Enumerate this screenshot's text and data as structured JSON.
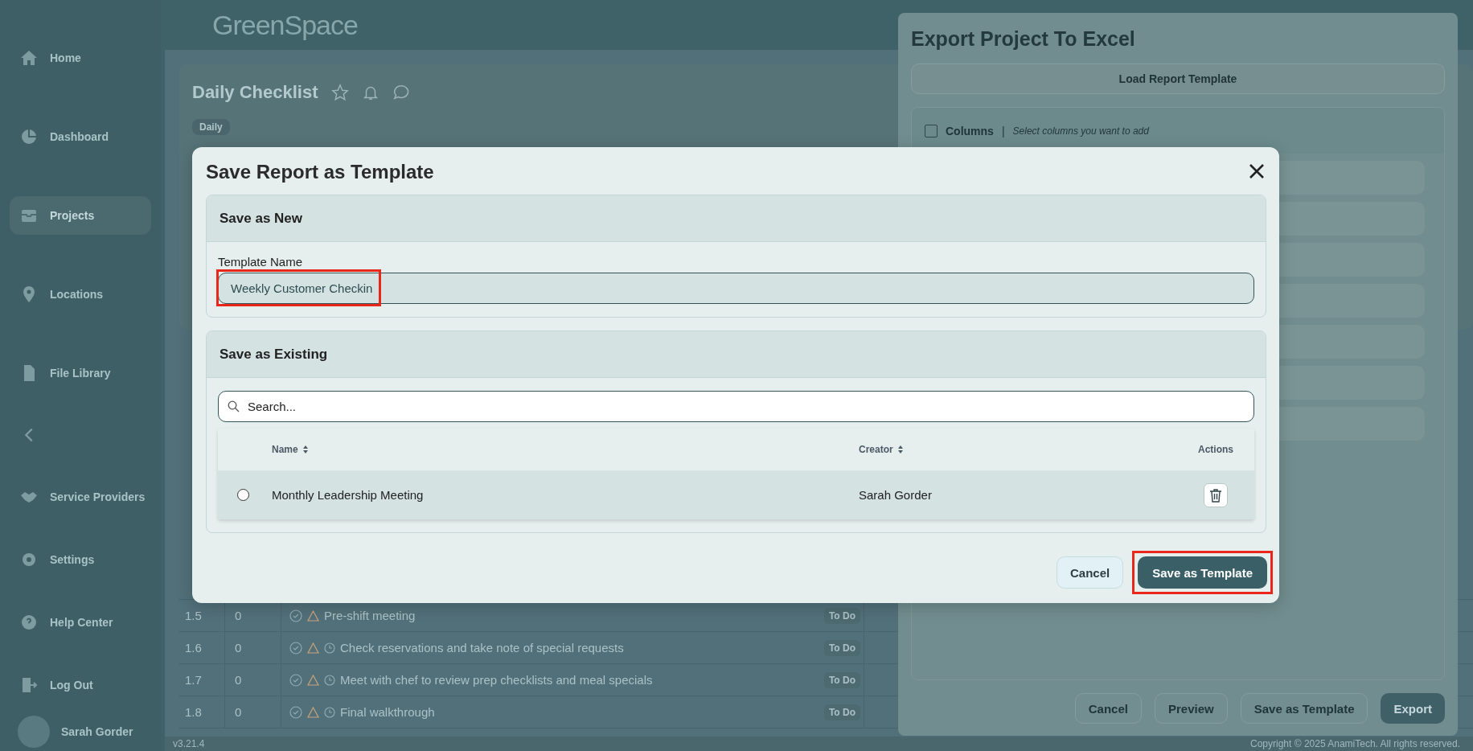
{
  "header": {
    "logo": "GreenSpace"
  },
  "sidebar": {
    "items": [
      {
        "label": "Home",
        "selected": false
      },
      {
        "label": "Dashboard",
        "selected": false
      },
      {
        "label": "Projects",
        "selected": true
      },
      {
        "label": "Locations",
        "selected": false
      },
      {
        "label": "File Library",
        "selected": false
      },
      {
        "label": "Service Providers",
        "selected": false
      },
      {
        "label": "Settings",
        "selected": false
      },
      {
        "label": "Help Center",
        "selected": false
      },
      {
        "label": "Log Out",
        "selected": false
      }
    ],
    "user": {
      "name": "Sarah Gorder"
    },
    "version": "v3.21.4"
  },
  "page": {
    "title": "Daily Checklist",
    "tag": "Daily",
    "rows": [
      {
        "number": "1.5",
        "count": "0",
        "task": "Pre-shift meeting",
        "clock": false,
        "status": "To Do"
      },
      {
        "number": "1.6",
        "count": "0",
        "task": "Check reservations and take note of special requests",
        "clock": true,
        "status": "To Do"
      },
      {
        "number": "1.7",
        "count": "0",
        "task": "Meet with chef to review prep checklists and meal specials",
        "clock": true,
        "status": "To Do"
      },
      {
        "number": "1.8",
        "count": "0",
        "task": "Final walkthrough",
        "clock": true,
        "status": "To Do"
      }
    ]
  },
  "export_panel": {
    "title": "Export Project To Excel",
    "load_button": "Load Report Template",
    "columns": {
      "label": "Columns",
      "separator": "|",
      "hint": "Select columns you want to add",
      "checked": false
    },
    "buttons": [
      {
        "label": "Cancel",
        "kind": "secondary"
      },
      {
        "label": "Preview",
        "kind": "secondary"
      },
      {
        "label": "Save as Template",
        "kind": "secondary"
      },
      {
        "label": "Export",
        "kind": "primary"
      }
    ]
  },
  "dialog": {
    "title": "Save Report as Template",
    "save_as_new": {
      "heading": "Save as New",
      "field_label": "Template Name",
      "value": "Weekly Customer Checkin",
      "highlighted": true
    },
    "save_as_existing": {
      "heading": "Save as Existing",
      "search": {
        "placeholder": "Search..."
      },
      "columns": [
        {
          "label": "Name",
          "sortable": true
        },
        {
          "label": "Creator",
          "sortable": true
        },
        {
          "label": "Actions",
          "sortable": false
        }
      ],
      "rows": [
        {
          "name": "Monthly Leadership Meeting",
          "creator": "Sarah Gorder",
          "selected": false
        }
      ]
    },
    "buttons": [
      {
        "label": "Cancel",
        "kind": "secondary",
        "highlighted": false
      },
      {
        "label": "Save as Template",
        "kind": "primary",
        "highlighted": true
      }
    ]
  },
  "footer": {
    "copyright": "Copyright © 2025 AnamiTech. All rights reserved."
  }
}
